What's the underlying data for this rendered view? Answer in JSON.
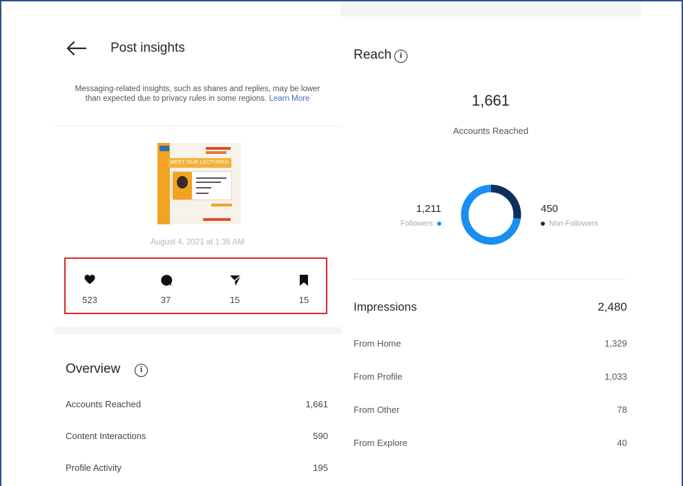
{
  "header": {
    "title": "Post insights",
    "notice_text": "Messaging-related insights, such as shares and replies, may be lower than expected due to privacy rules in some regions.",
    "notice_link": "Learn More"
  },
  "post": {
    "thumbnail_header_text": "MEET OUR LECTURER",
    "date": "August 4, 2021 at 1:35 AM"
  },
  "metrics": [
    {
      "icon": "heart-icon",
      "value": "523"
    },
    {
      "icon": "comment-icon",
      "value": "37"
    },
    {
      "icon": "share-icon",
      "value": "15"
    },
    {
      "icon": "bookmark-icon",
      "value": "15"
    }
  ],
  "overview": {
    "title": "Overview",
    "rows": [
      {
        "label": "Accounts Reached",
        "value": "1,661"
      },
      {
        "label": "Content Interactions",
        "value": "590"
      },
      {
        "label": "Profile Activity",
        "value": "195"
      }
    ]
  },
  "reach": {
    "title": "Reach",
    "total": "1,661",
    "total_label": "Accounts Reached",
    "followers_value": "1,211",
    "followers_label": "Followers",
    "non_followers_value": "450",
    "non_followers_label": "Non-Followers",
    "followers_fraction": 0.729,
    "colors": {
      "followers": "#1b8ef2",
      "non_followers": "#0f2f5c"
    }
  },
  "impressions": {
    "title": "Impressions",
    "total": "2,480",
    "rows": [
      {
        "label": "From Home",
        "value": "1,329"
      },
      {
        "label": "From Profile",
        "value": "1,033"
      },
      {
        "label": "From Other",
        "value": "78"
      },
      {
        "label": "From Explore",
        "value": "40"
      }
    ]
  },
  "colors": {
    "highlight_border": "#e0242a",
    "link": "#3a72b8"
  }
}
